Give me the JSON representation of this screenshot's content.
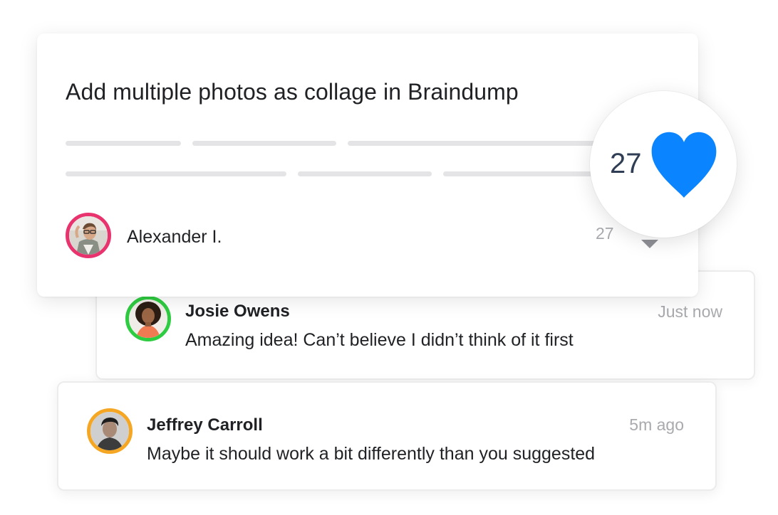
{
  "idea": {
    "title": "Add multiple photos as collage in Braindump",
    "author": {
      "name": "Alexander I.",
      "avatar_icon": "person-photo-icon",
      "ring_color": "#e8336f"
    },
    "vote_count": "27",
    "like_count": "27",
    "heart_color": "#0a84ff"
  },
  "comments": [
    {
      "name": "Josie Owens",
      "text": "Amazing idea! Can’t believe I didn’t think of it first",
      "time": "Just now",
      "ring_color": "#2ecc40"
    },
    {
      "name": "Jeffrey Carroll",
      "text": "Maybe it should work a bit differently than you suggested",
      "time": "5m ago",
      "ring_color": "#f5a623"
    }
  ]
}
